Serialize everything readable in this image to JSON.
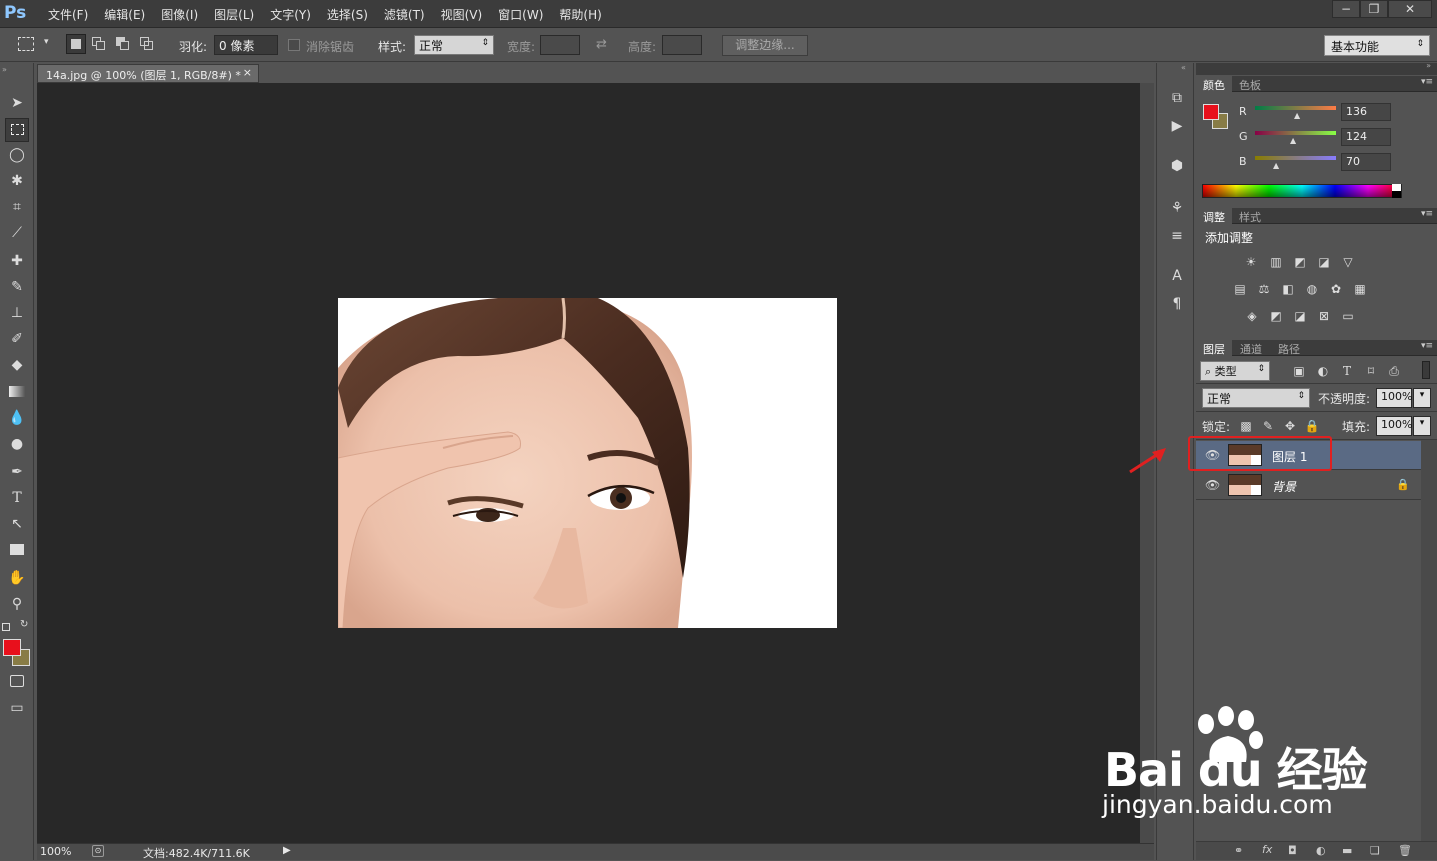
{
  "app": {
    "logo": "Ps"
  },
  "menu": [
    "文件(F)",
    "编辑(E)",
    "图像(I)",
    "图层(L)",
    "文字(Y)",
    "选择(S)",
    "滤镜(T)",
    "视图(V)",
    "窗口(W)",
    "帮助(H)"
  ],
  "window_buttons": [
    "−",
    "❐",
    "✕"
  ],
  "options": {
    "feather_label": "羽化:",
    "feather_value": "0 像素",
    "antialias_label": "消除锯齿",
    "style_label": "样式:",
    "style_value": "正常",
    "width_label": "宽度:",
    "height_label": "高度:",
    "refine_label": "调整边缘...",
    "workspace": "基本功能"
  },
  "document": {
    "tab_title": "14a.jpg @ 100% (图层 1, RGB/8#) *",
    "close": "×"
  },
  "status": {
    "zoom": "100%",
    "doc_info": "文档:482.4K/711.6K"
  },
  "color_panel": {
    "tabs": [
      "颜色",
      "色板"
    ],
    "r_label": "R",
    "g_label": "G",
    "b_label": "B",
    "r": "136",
    "g": "124",
    "b": "70",
    "fg": "#e8101c",
    "bg": "#887c46"
  },
  "adjust_panel": {
    "tabs": [
      "调整",
      "样式"
    ],
    "title": "添加调整"
  },
  "layers_panel": {
    "tabs": [
      "图层",
      "通道",
      "路径"
    ],
    "filter_label": "类型",
    "blend_mode": "正常",
    "opacity_label": "不透明度:",
    "opacity": "100%",
    "lock_label": "锁定:",
    "fill_label": "填充:",
    "fill": "100%",
    "layers": [
      {
        "name": "图层 1",
        "selected": true
      },
      {
        "name": "背景",
        "selected": false
      }
    ]
  },
  "watermark": {
    "brand": "Bai du 经验",
    "url": "jingyan.baidu.com"
  },
  "accent": {
    "highlight": "#e02020",
    "selection": "#5a6a84"
  }
}
